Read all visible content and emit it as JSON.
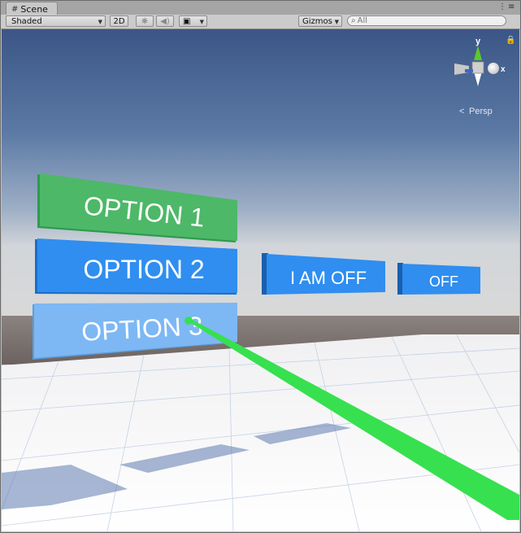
{
  "tab": {
    "title": "Scene"
  },
  "toolbar": {
    "shading_mode": "Shaded",
    "mode_2d": "2D",
    "gizmos_label": "Gizmos",
    "search_placeholder": "All"
  },
  "gizmo": {
    "y_label": "y",
    "x_label": "x",
    "projection": "Persp"
  },
  "scene": {
    "panels": [
      {
        "label": "OPTION 1",
        "color": "#4db868"
      },
      {
        "label": "OPTION 2",
        "color": "#2f8ef0"
      },
      {
        "label": "OPTION 3",
        "color": "#7db8f4"
      },
      {
        "label": "I AM OFF",
        "color": "#2f8ef0"
      },
      {
        "label": "OFF",
        "color": "#2f8ef0"
      }
    ],
    "pointer_color": "#37e04f"
  }
}
